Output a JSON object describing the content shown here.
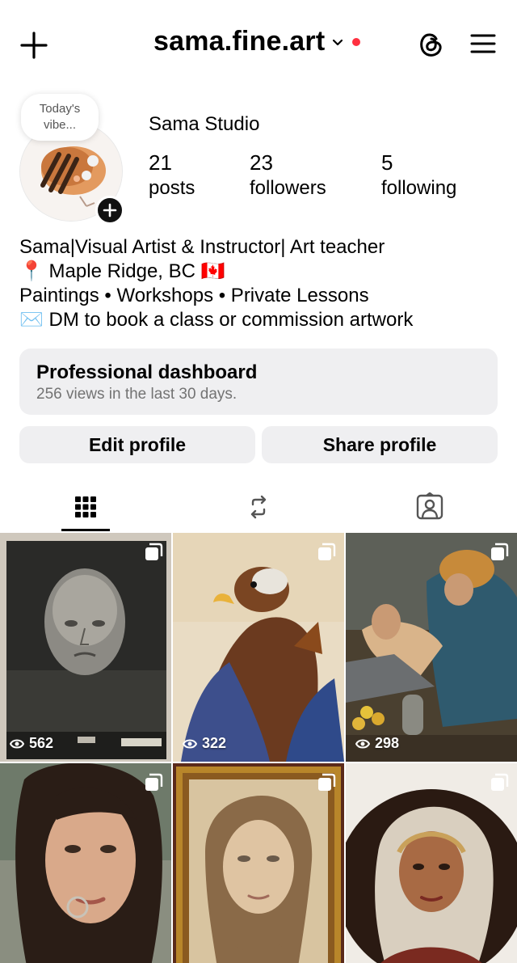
{
  "header": {
    "username": "sama.fine.art",
    "plus_icon": "plus-icon",
    "threads_icon": "threads-icon",
    "menu_icon": "hamburger-menu-icon",
    "notification_color": "#ff3040"
  },
  "profile": {
    "note_line1": "Today's",
    "note_line2": "vibe...",
    "display_name": "Sama Studio",
    "stats": [
      {
        "value": "21",
        "label": "posts"
      },
      {
        "value": "23",
        "label": "followers"
      },
      {
        "value": "5",
        "label": "following"
      }
    ]
  },
  "bio": {
    "line1": "Sama|Visual Artist & Instructor| Art teacher",
    "line2": "📍 Maple Ridge, BC 🇨🇦",
    "line3": "Paintings • Workshops • Private Lessons",
    "line4": "✉️ DM to book a class or commission artwork"
  },
  "dashboard": {
    "title": "Professional dashboard",
    "subtitle": "256 views in the last 30 days."
  },
  "actions": {
    "edit_label": "Edit profile",
    "share_label": "Share profile"
  },
  "tabs": [
    {
      "icon": "grid-icon",
      "active": true
    },
    {
      "icon": "reposts-icon",
      "active": false
    },
    {
      "icon": "tagged-icon",
      "active": false
    }
  ],
  "posts": [
    {
      "views": "562",
      "subject": "stone-face-sculpture"
    },
    {
      "views": "322",
      "subject": "eagle-painting"
    },
    {
      "views": "298",
      "subject": "figures-painting"
    },
    {
      "views": "",
      "subject": "woman-portrait"
    },
    {
      "views": "",
      "subject": "framed-portrait"
    },
    {
      "views": "",
      "subject": "headscarf-portrait"
    }
  ]
}
